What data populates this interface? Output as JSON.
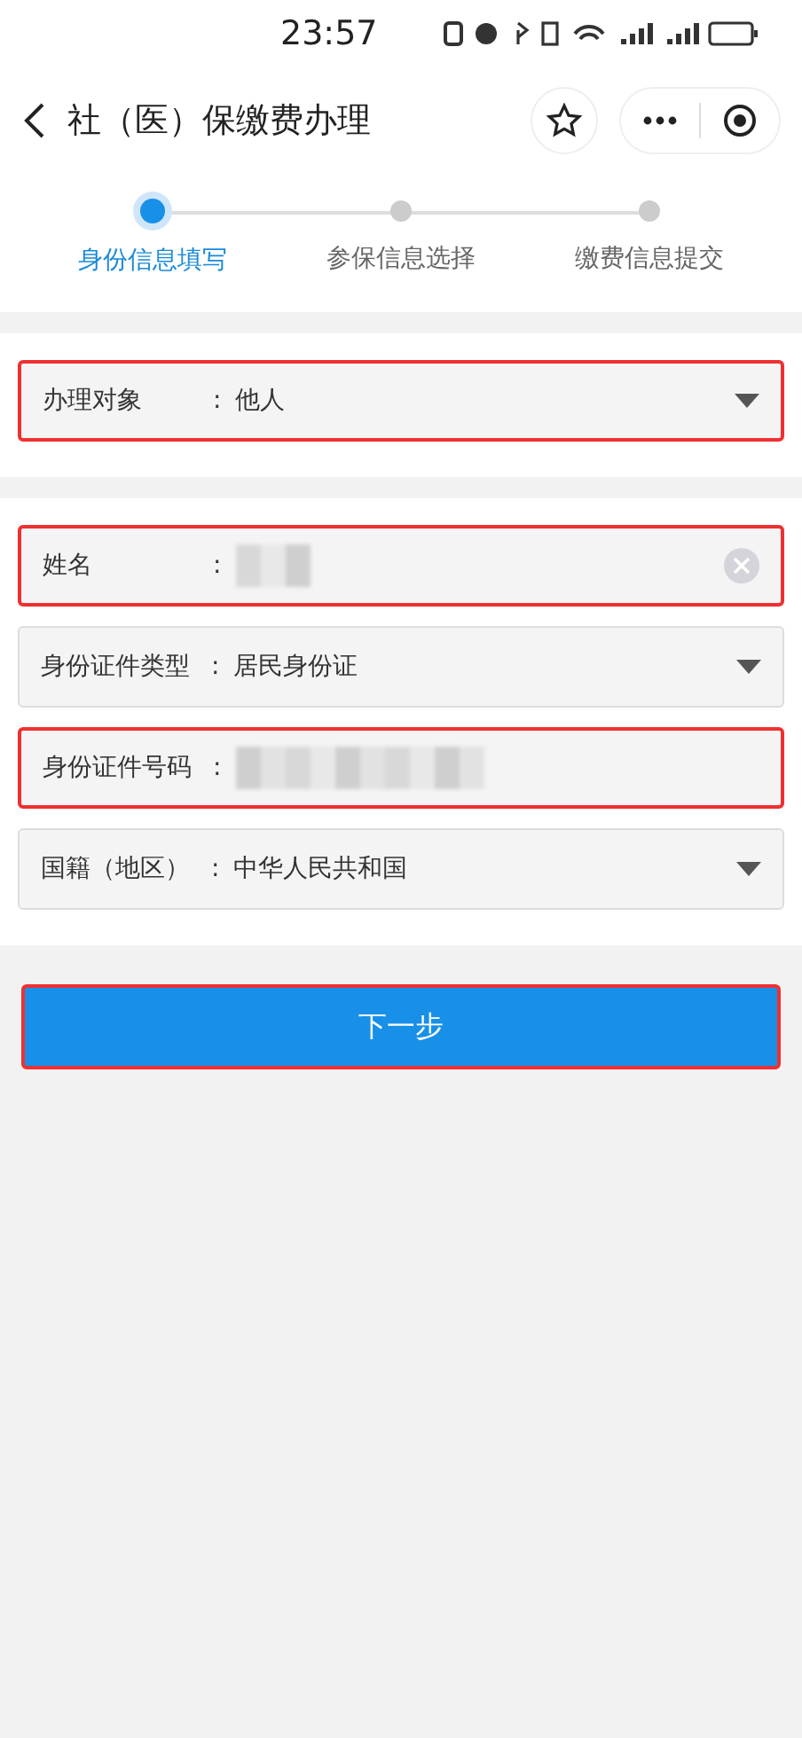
{
  "status_bar": {
    "time": "23:57"
  },
  "nav_bar": {
    "title": "社（医）保缴费办理"
  },
  "steps": [
    {
      "label": "身份信息填写",
      "selected": true
    },
    {
      "label": "参保信息选择",
      "selected": false
    },
    {
      "label": "缴费信息提交",
      "selected": false
    }
  ],
  "sections": [
    {
      "fields": [
        {
          "kind": "select",
          "label": "办理对象",
          "separator": ":",
          "value": "他人",
          "highlighted": true
        }
      ]
    },
    {
      "fields": [
        {
          "kind": "input",
          "label": "姓名",
          "separator": ":",
          "redacted": true,
          "highlighted": true
        },
        {
          "kind": "select",
          "label": "身份证件类型",
          "separator": ":",
          "value": "居民身份证",
          "highlighted": false
        },
        {
          "kind": "text",
          "label": "身份证件号码",
          "separator": ":",
          "redacted": true,
          "highlighted": true
        },
        {
          "kind": "select",
          "label": "国籍（地区）",
          "separator": ":",
          "value": "中华人民共和国",
          "highlighted": false
        }
      ]
    }
  ],
  "next_button": {
    "label": "下一步",
    "highlighted": true
  }
}
